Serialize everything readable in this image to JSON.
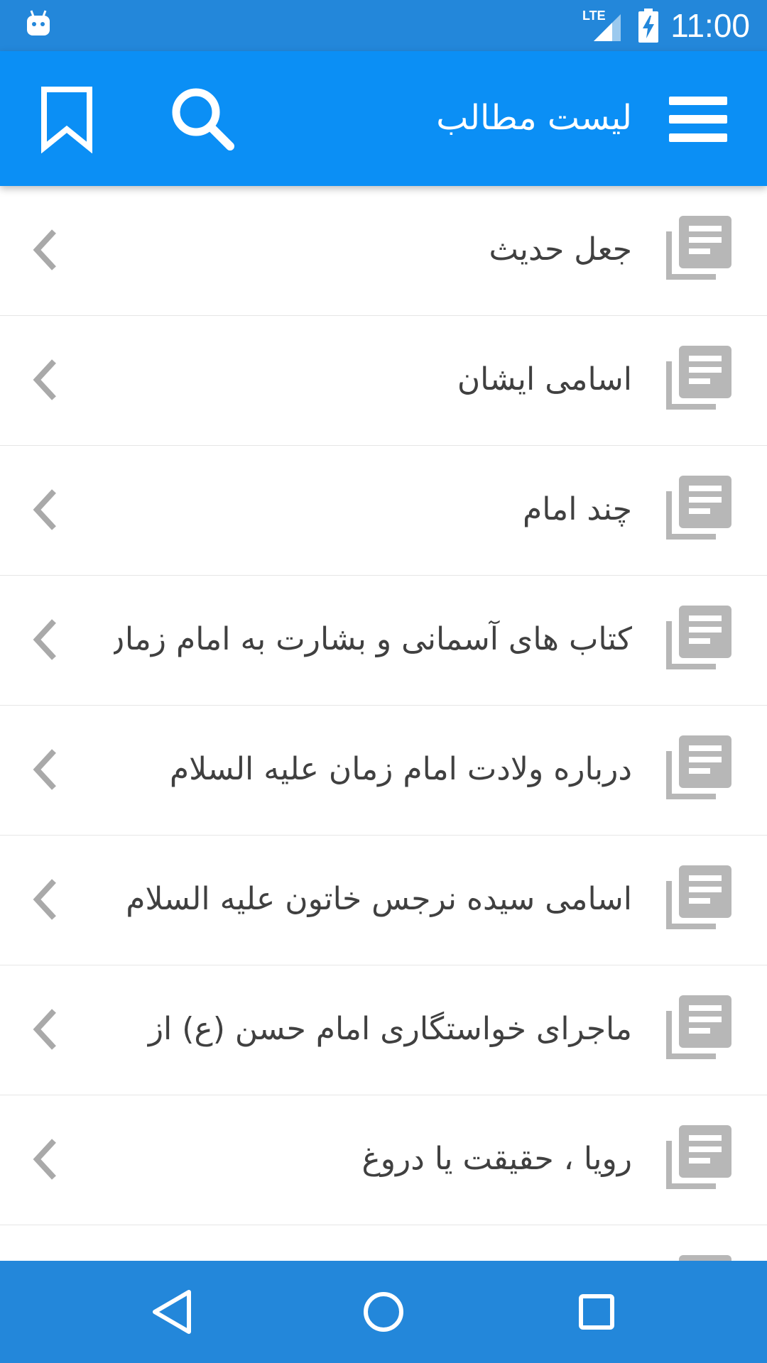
{
  "status_bar": {
    "time": "11:00",
    "network_label": "LTE",
    "icons": [
      "android-notification-icon",
      "lte-signal-icon",
      "battery-charging-icon"
    ]
  },
  "app_bar": {
    "title": "لیست مطالب",
    "icons": [
      "hamburger-menu-icon",
      "search-icon",
      "bookmark-icon"
    ],
    "color": "#0b8ff5"
  },
  "list": {
    "items": [
      {
        "label": "جعل حدیث"
      },
      {
        "label": "اسامی ایشان"
      },
      {
        "label": "چند امام"
      },
      {
        "label": "کتاب های آسمانی و بشارت به امام زمان"
      },
      {
        "label": "درباره ولادت امام زمان علیه السلام"
      },
      {
        "label": "اسامی سیده نرجس خاتون علیه السلام"
      },
      {
        "label": "ماجرای خواستگاری امام حسن (ع) از"
      },
      {
        "label": "رویا ، حقیقت یا دروغ"
      }
    ],
    "item_icon": "library-books-icon",
    "trailing_icon": "chevron-left-icon"
  },
  "nav_bar": {
    "icons": [
      "back-triangle-icon",
      "home-circle-icon",
      "recents-square-icon"
    ],
    "color": "#2387da"
  }
}
